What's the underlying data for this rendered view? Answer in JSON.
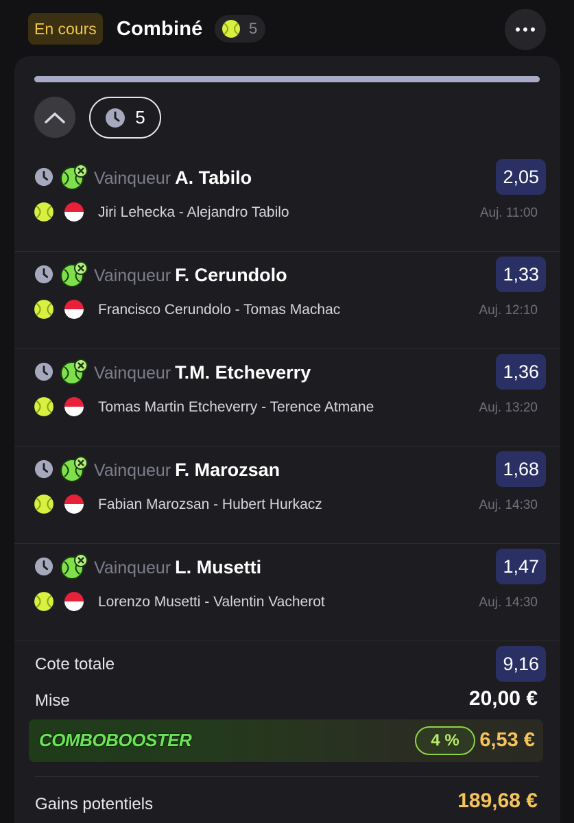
{
  "header": {
    "status": "En cours",
    "title": "Combiné",
    "count": "5",
    "more_icon": "more-horizontal-icon"
  },
  "progress": {
    "fraction": 1.0
  },
  "toolbar": {
    "pending_count": "5"
  },
  "selections": [
    {
      "label": "Vainqueur",
      "pick": "A. Tabilo",
      "odd": "2,05",
      "match": "Jiri Lehecka - Alejandro Tabilo",
      "time": "Auj. 11:00"
    },
    {
      "label": "Vainqueur",
      "pick": "F. Cerundolo",
      "odd": "1,33",
      "match": "Francisco Cerundolo - Tomas Machac",
      "time": "Auj. 12:10"
    },
    {
      "label": "Vainqueur",
      "pick": "T.M. Etcheverry",
      "odd": "1,36",
      "match": "Tomas Martin Etcheverry - Terence Atmane",
      "time": "Auj. 13:20"
    },
    {
      "label": "Vainqueur",
      "pick": "F. Marozsan",
      "odd": "1,68",
      "match": "Fabian Marozsan - Hubert Hurkacz",
      "time": "Auj. 14:30"
    },
    {
      "label": "Vainqueur",
      "pick": "L. Musetti",
      "odd": "1,47",
      "match": "Lorenzo Musetti - Valentin Vacherot",
      "time": "Auj. 14:30"
    }
  ],
  "summary": {
    "total_odds_label": "Cote totale",
    "total_odds": "9,16",
    "stake_label": "Mise",
    "stake": "20,00 €",
    "booster_logo": "COMBOBOOSTER",
    "booster_pct": "4 %",
    "booster_amount": "6,53 €",
    "gains_label": "Gains potentiels",
    "gains": "189,68 €"
  },
  "colors": {
    "background": "#121214",
    "card": "#1d1d21",
    "status_text": "#f1c64b",
    "odd_badge": "#2a3064",
    "accent_gold": "#f4c45a",
    "booster_green": "#8fd44a"
  }
}
